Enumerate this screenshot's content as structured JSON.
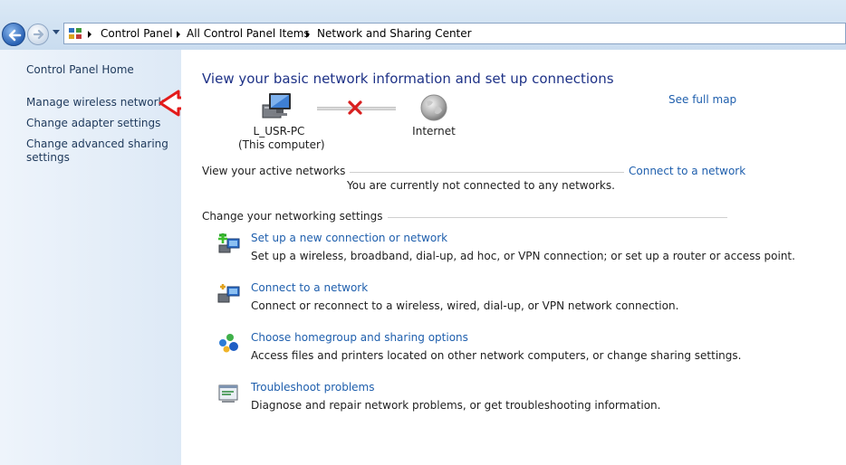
{
  "breadcrumb": {
    "items": [
      "Control Panel",
      "All Control Panel Items",
      "Network and Sharing Center"
    ]
  },
  "sidebar": {
    "home": "Control Panel Home",
    "items": [
      "Manage wireless networks",
      "Change adapter settings",
      "Change advanced sharing",
      "settings"
    ]
  },
  "main": {
    "title": "View your basic network information and set up connections",
    "see_full_map": "See full map",
    "computer_name": "L_USR-PC",
    "computer_sub": "(This computer)",
    "internet_label": "Internet",
    "active_networks_title": "View your active networks",
    "connect_link": "Connect to a network",
    "not_connected": "You are currently not connected to any networks.",
    "change_settings_title": "Change your networking settings",
    "tasks": [
      {
        "link": "Set up a new connection or network",
        "desc": "Set up a wireless, broadband, dial-up, ad hoc, or VPN connection; or set up a router or access point.",
        "icon": "new-connection-icon"
      },
      {
        "link": "Connect to a network",
        "desc": "Connect or reconnect to a wireless, wired, dial-up, or VPN network connection.",
        "icon": "connect-network-icon"
      },
      {
        "link": "Choose homegroup and sharing options",
        "desc": "Access files and printers located on other network computers, or change sharing settings.",
        "icon": "homegroup-icon"
      },
      {
        "link": "Troubleshoot problems",
        "desc": "Diagnose and repair network problems, or get troubleshooting information.",
        "icon": "troubleshoot-icon"
      }
    ]
  },
  "colors": {
    "link": "#1f5fad",
    "title": "#1e3287",
    "annotation_arrow": "#e31b1b",
    "disconnected_x": "#d81f1f"
  }
}
